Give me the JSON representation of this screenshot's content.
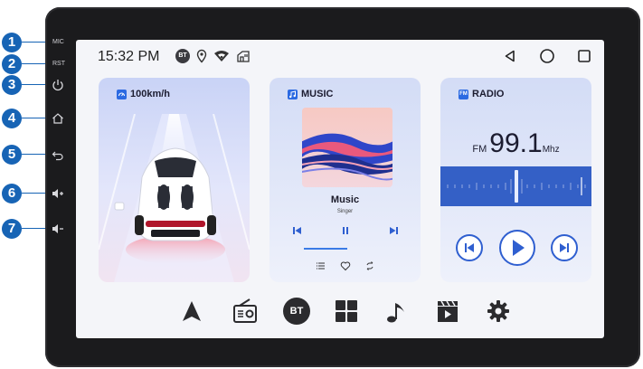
{
  "callouts": [
    {
      "number": "1",
      "label": "MIC"
    },
    {
      "number": "2",
      "label": "RST"
    },
    {
      "number": "3",
      "icon": "power-icon"
    },
    {
      "number": "4",
      "icon": "home-icon"
    },
    {
      "number": "5",
      "icon": "back-icon"
    },
    {
      "number": "6",
      "icon": "volume-up-icon"
    },
    {
      "number": "7",
      "icon": "volume-down-icon"
    }
  ],
  "status": {
    "time": "15:32 PM",
    "bt_label": "BT",
    "icons": [
      "bluetooth-icon",
      "location-icon",
      "wifi-icon",
      "usb-icon"
    ]
  },
  "nav": [
    "back-triangle-icon",
    "home-circle-icon",
    "recents-square-icon"
  ],
  "speed_card": {
    "title": "100km/h"
  },
  "music_card": {
    "title": "MUSIC",
    "song": "Music",
    "artist": "Singer",
    "progress": 0.3
  },
  "radio_card": {
    "title": "RADIO",
    "title_icon_text": "FM",
    "band": "FM",
    "frequency": "99.1",
    "unit": "Mhz"
  },
  "dock": {
    "bt_label": "BT",
    "items": [
      "navigation-icon",
      "radio-icon",
      "bluetooth-icon",
      "apps-icon",
      "music-note-icon",
      "video-icon",
      "settings-icon"
    ]
  },
  "colors": {
    "accent": "#2f5fd0",
    "callout": "#1764b5",
    "bezel": "#1b1b1d"
  }
}
